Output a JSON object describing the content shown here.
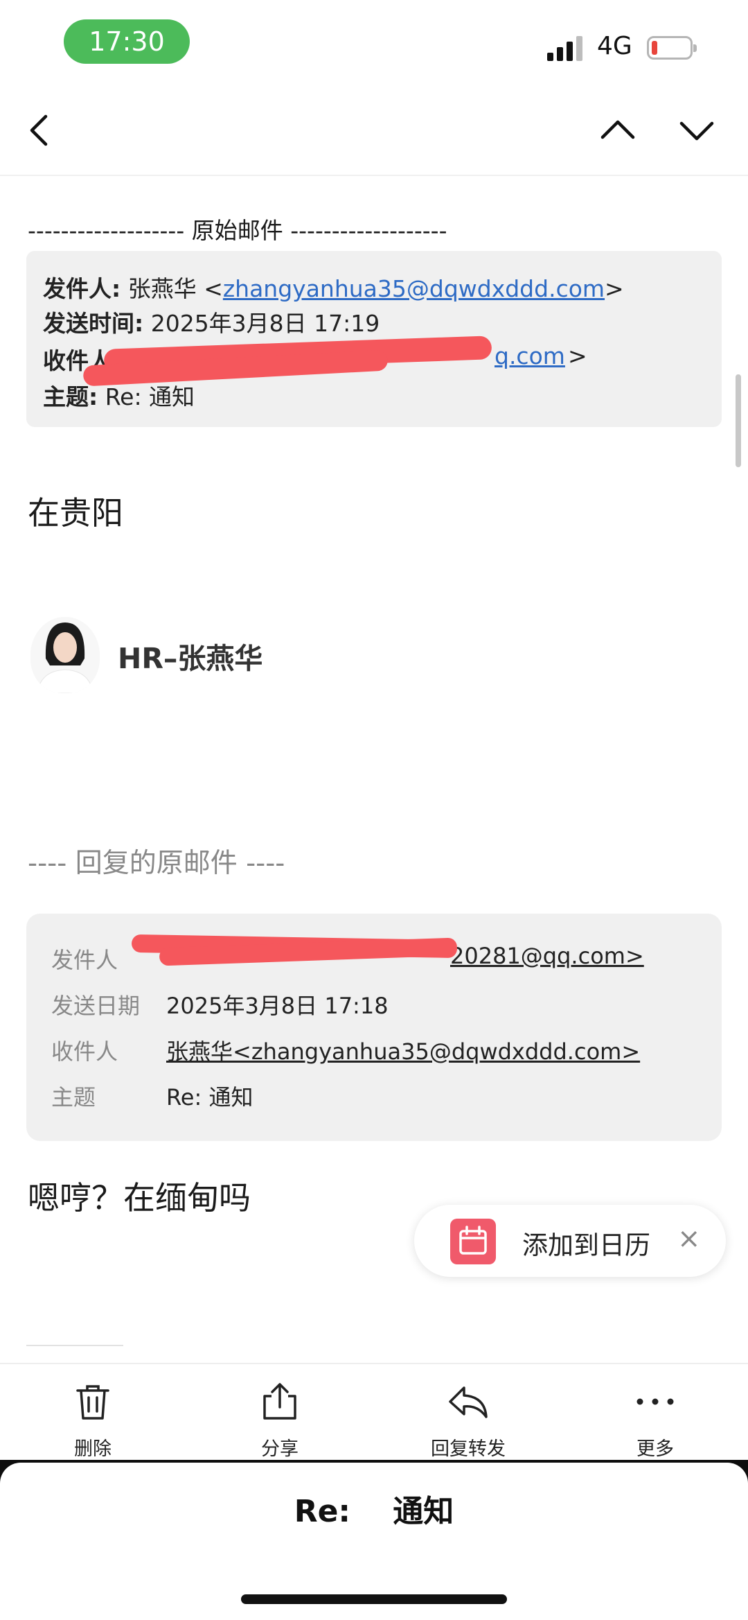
{
  "status_bar": {
    "time": "17:30",
    "network": "4G"
  },
  "original_mail": {
    "separator": "------------------- 原始邮件 -------------------",
    "from_label": "发件人:",
    "from_name": "张燕华",
    "from_email": "zhangyanhua35@dqwdxddd.com",
    "sent_label": "发送时间:",
    "sent_value": "2025年3月8日 17:19",
    "to_label": "收件人",
    "to_visible_suffix": "q.com",
    "subject_label": "主题:",
    "subject_value": "Re: 通知"
  },
  "body_line_1": "在贵阳",
  "signature": {
    "name": "HR–张燕华"
  },
  "reply_separator": "---- 回复的原邮件 ----",
  "reply_header": {
    "from_label": "发件人",
    "from_visible": "20281@qq.com>",
    "date_label": "发送日期",
    "date_value": "2025年3月8日 17:18",
    "to_label": "收件人",
    "to_value": "张燕华<zhangyanhua35@dqwdxddd.com>",
    "subject_label": "主题",
    "subject_value": "Re: 通知"
  },
  "body_line_2": "嗯哼？在缅甸吗",
  "calendar_pill": {
    "label": "添加到日历",
    "close": "×"
  },
  "toolbar": {
    "delete": "删除",
    "share": "分享",
    "reply_forward": "回复转发",
    "more": "更多"
  },
  "sheet": {
    "title": "Re:    通知"
  },
  "colors": {
    "link": "#2e6bc5",
    "accent_green": "#4cbb5a",
    "calendar_red": "#f05a6b",
    "redaction": "#f5575c"
  }
}
